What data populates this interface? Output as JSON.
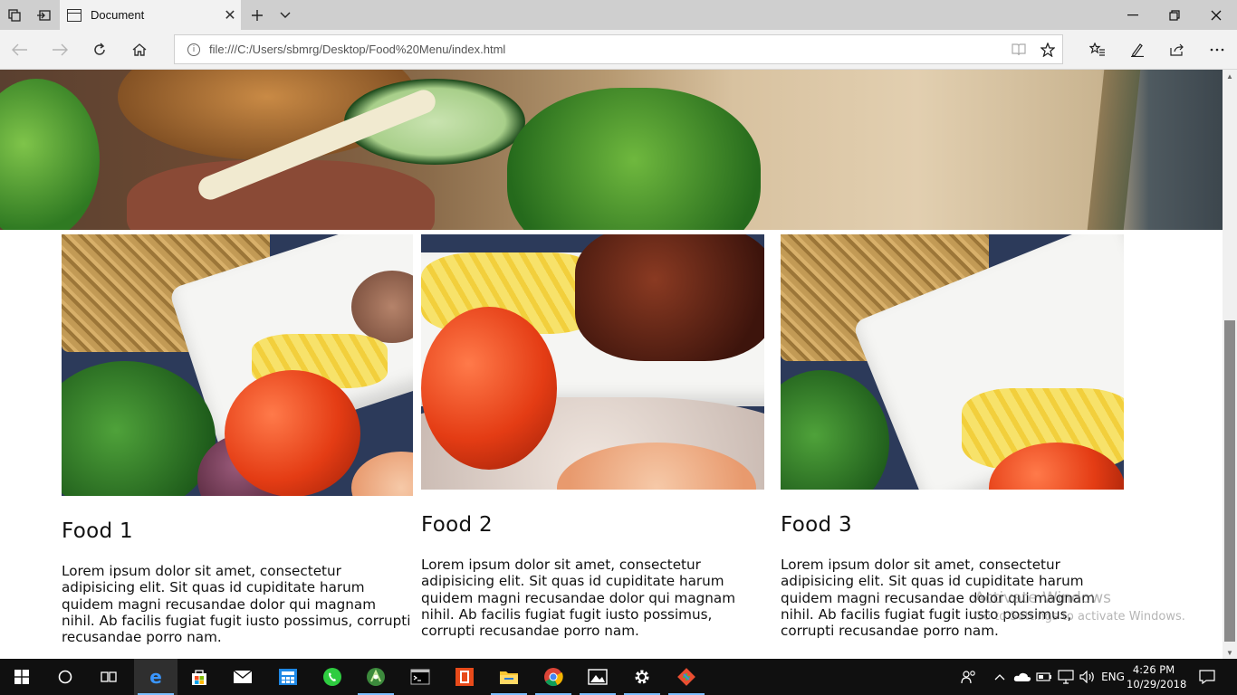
{
  "browser": {
    "tab_title": "Document",
    "url": "file:///C:/Users/sbmrg/Desktop/Food%20Menu/index.html"
  },
  "cards": [
    {
      "title": "Food 1",
      "text": "Lorem ipsum dolor sit amet, consectetur adipisicing elit. Sit quas id cupiditate harum quidem magni recusandae dolor qui magnam nihil. Ab facilis fugiat fugit iusto possimus, corrupti recusandae porro nam."
    },
    {
      "title": "Food 2",
      "text": "Lorem ipsum dolor sit amet, consectetur adipisicing elit. Sit quas id cupiditate harum quidem magni recusandae dolor qui magnam nihil. Ab facilis fugiat fugit iusto possimus, corrupti recusandae porro nam."
    },
    {
      "title": "Food 3",
      "text": "Lorem ipsum dolor sit amet, consectetur adipisicing elit. Sit quas id cupiditate harum quidem magni recusandae dolor qui magnam nihil. Ab facilis fugiat fugit iusto possimus, corrupti recusandae porro nam."
    }
  ],
  "watermark": {
    "line1": "Activate Windows",
    "line2": "Go to Settings to activate Windows."
  },
  "taskbar": {
    "language": "ENG",
    "time": "4:26 PM",
    "date": "10/29/2018"
  },
  "colors": {
    "taskbar_bg": "#101010",
    "edge_blue": "#1e88e5",
    "active_indicator": "#7cbfff"
  },
  "icons": [
    "tab-actions-icon",
    "set-aside-icon",
    "new-tab-icon",
    "tab-preview-icon",
    "back-icon",
    "forward-icon",
    "refresh-icon",
    "home-icon",
    "site-info-icon",
    "reading-view-icon",
    "favorite-star-icon",
    "favorites-hub-icon",
    "notes-pen-icon",
    "share-icon",
    "more-icon",
    "windows-start-icon",
    "cortana-icon",
    "task-view-icon",
    "edge-icon",
    "store-icon",
    "mail-icon",
    "calculator-icon",
    "whatsapp-icon",
    "android-studio-icon",
    "terminal-icon",
    "office-icon",
    "file-explorer-icon",
    "chrome-icon",
    "photos-icon",
    "settings-icon",
    "git-icon",
    "people-icon",
    "onedrive-icon",
    "battery-icon",
    "network-icon",
    "volume-icon",
    "action-center-icon"
  ]
}
